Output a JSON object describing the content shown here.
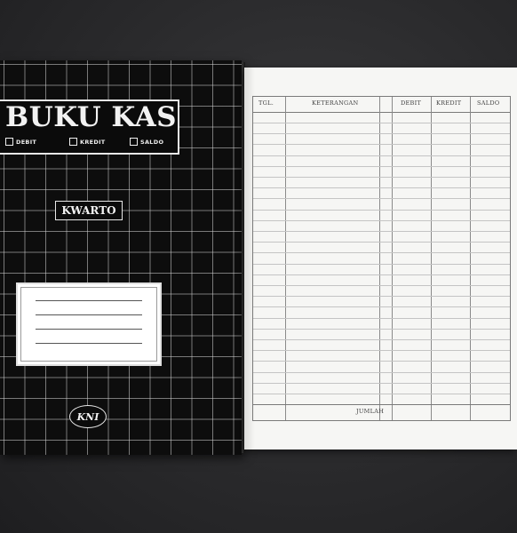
{
  "cover": {
    "title": "BUKU KAS",
    "options": [
      "DEBIT",
      "KREDIT",
      "SALDO"
    ],
    "size_label": "KWARTO",
    "brand": "KNI",
    "colors": {
      "cover_bg": "#0d0d0d",
      "grid": "#d2d2d2",
      "text": "#f2f2f2"
    }
  },
  "ledger": {
    "columns": [
      "TGL.",
      "KETERANGAN",
      "DEBIT",
      "KREDIT",
      "SALDO"
    ],
    "footer_label": "JUMLAH",
    "colors": {
      "paper": "#f6f6f4",
      "rule": "#c4c4c4"
    }
  }
}
